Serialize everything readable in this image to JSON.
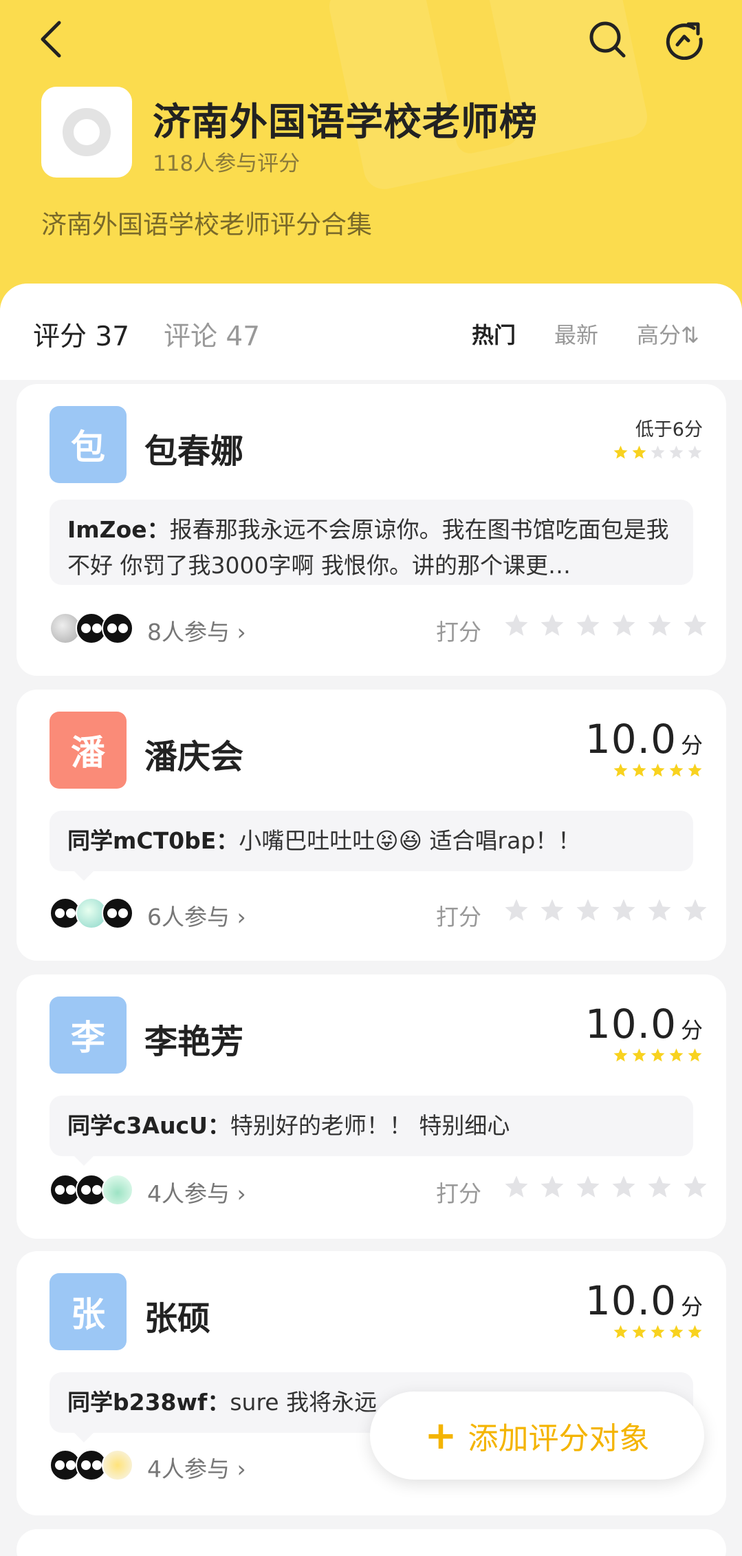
{
  "colors": {
    "header_bg": "#fbdc4e",
    "accent": "#f4b400",
    "star": "#f8d21f",
    "star_empty": "#e3e3e6"
  },
  "header": {
    "title": "济南外国语学校老师榜",
    "subtitle": "118人参与评分",
    "description": "济南外国语学校老师评分合集"
  },
  "tabs": {
    "ratings": "评分 37",
    "comments": "评论 47",
    "sort_hot": "热门",
    "sort_new": "最新",
    "sort_high": "高分⇅"
  },
  "cards": [
    {
      "initial": "包",
      "name": "包春娜",
      "avatar_color": "#9cc7f5",
      "score_text": "低于6分",
      "score_stars": 2,
      "author": "ImZoe：",
      "comment": "报春那我永远不会原谅你。我在图书馆吃面包是我不好 你罚了我3000字啊 我恨你。讲的那个课更…",
      "participants": "8人参与",
      "rate_label": "打分"
    },
    {
      "initial": "潘",
      "name": "潘庆会",
      "avatar_color": "#fa8b78",
      "score": "10.0",
      "unit": "分",
      "score_stars": 5,
      "author": "同学mCT0bE：",
      "comment": "小嘴巴吐吐吐😝😆 适合唱rap！！",
      "participants": "6人参与",
      "rate_label": "打分"
    },
    {
      "initial": "李",
      "name": "李艳芳",
      "avatar_color": "#9cc7f5",
      "score": "10.0",
      "unit": "分",
      "score_stars": 5,
      "author": "同学c3AucU：",
      "comment": "特别好的老师！！ 特别细心",
      "participants": "4人参与",
      "rate_label": "打分"
    },
    {
      "initial": "张",
      "name": "张硕",
      "avatar_color": "#9cc7f5",
      "score": "10.0",
      "unit": "分",
      "score_stars": 5,
      "author": "同学b238wf：",
      "comment": "sure 我将永远",
      "participants": "4人参与",
      "rate_label": "打分"
    }
  ],
  "add_button": {
    "icon": "plus-icon",
    "label": "添加评分对象"
  }
}
